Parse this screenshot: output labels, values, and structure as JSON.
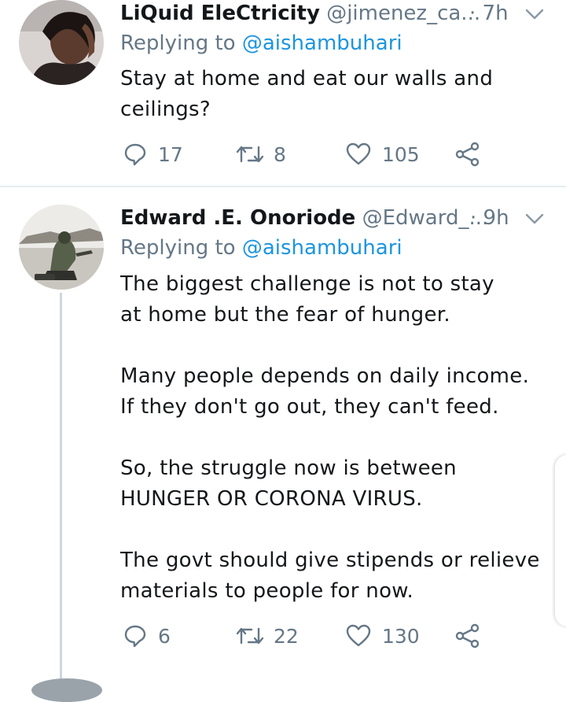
{
  "tweets": [
    {
      "name": "LiQuid EleCtricity",
      "handle": "@jimenez_ca...",
      "time": "· 7h",
      "replying_prefix": "Replying to",
      "replying_to": "@aishambuhari",
      "text": [
        "Stay at home and eat our walls and ceilings?"
      ],
      "replies": "17",
      "retweets": "8",
      "likes": "105"
    },
    {
      "name": "Edward .E. Onoriode",
      "handle": "@Edward_...",
      "time": "· 9h",
      "replying_prefix": "Replying to",
      "replying_to": "@aishambuhari",
      "text": [
        "The biggest challenge is not to stay at home but the fear of hunger.",
        "Many people depends on daily income. If they don't go out, they can't feed.",
        "So, the struggle now is between HUNGER OR CORONA VIRUS.",
        "The govt should give stipends or relieve materials to people for now."
      ],
      "replies": "6",
      "retweets": "22",
      "likes": "130"
    }
  ],
  "icons": {
    "reply": "reply-icon",
    "retweet": "retweet-icon",
    "like": "heart-icon",
    "share": "share-icon",
    "menu": "chevron-down-icon"
  },
  "colors": {
    "text": "#14171a",
    "muted": "#657786",
    "mention": "#1b95e0",
    "divider": "#e6ecf0"
  }
}
